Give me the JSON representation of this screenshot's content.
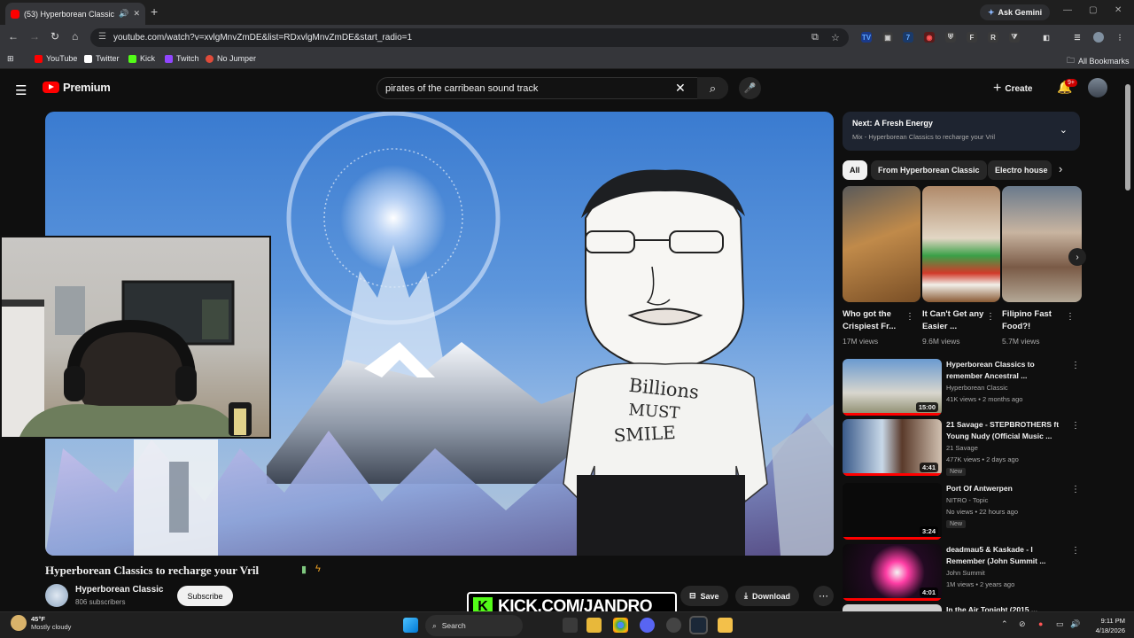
{
  "browser": {
    "tab_title": "(53) Hyperborean Classics to recharge your Vril",
    "new_tab_icon": "plus-icon",
    "gemini_label": "Ask Gemini",
    "url": "youtube.com/watch?v=xvlgMnvZmDE&list=RDxvlgMnvZmDE&start_radio=1",
    "bookmarks": [
      {
        "label": "YouTube",
        "color": "#ff0000"
      },
      {
        "label": "Twitter",
        "color": "#ffffff"
      },
      {
        "label": "Kick",
        "color": "#53fc18"
      },
      {
        "label": "Twitch",
        "color": "#9146ff"
      },
      {
        "label": "No Jumper",
        "color": "#e04b3a"
      }
    ],
    "all_bookmarks": "All Bookmarks"
  },
  "youtube": {
    "logo_text": "Premium",
    "search_value": "pirates of the carribean sound track",
    "create_label": "Create",
    "notif_count": "9+"
  },
  "video": {
    "title": "Hyperborean Classics to recharge your Vril",
    "channel": "Hyperborean Classic",
    "subscribers": "806 subscribers",
    "subscribe_label": "Subscribe",
    "save_label": "Save",
    "download_label": "Download",
    "shirt_line1": "Billions",
    "shirt_line2": "MUST",
    "shirt_line3": "SMILE"
  },
  "sidebar": {
    "up_next_label": "Next:",
    "up_next_title": "A Fresh Energy",
    "up_next_sub": "Mix - Hyperborean Classics to recharge your Vril",
    "chips": [
      "All",
      "From Hyperborean Classic",
      "Electro house"
    ],
    "shorts": [
      {
        "title": "Who got the Crispiest Fr...",
        "views": "17M views",
        "color": "#8a6a3c"
      },
      {
        "title": "It Can't Get any Easier ...",
        "views": "9.6M views",
        "color": "#9a5a3a"
      },
      {
        "title": "Filipino Fast Food?!",
        "views": "5.7M views",
        "color": "#7a6150"
      }
    ],
    "recs": [
      {
        "title": "Hyperborean Classics to remember Ancestral ...",
        "channel": "Hyperborean Classic",
        "views": "41K views • 2 months ago",
        "badge": "",
        "duration": "15:00"
      },
      {
        "title": "21 Savage - STEPBROTHERS ft Young Nudy (Official Music ...",
        "channel": "21 Savage",
        "views": "477K views • 2 days ago",
        "badge": "New",
        "duration": "4:41"
      },
      {
        "title": "Port Of Antwerpen",
        "channel": "NITRO - Topic",
        "views": "No views • 22 hours ago",
        "badge": "New",
        "duration": "3:24"
      },
      {
        "title": "deadmau5 & Kaskade - I Remember (John Summit ...",
        "channel": "John Summit",
        "views": "1M views • 2 years ago",
        "badge": "",
        "duration": "4:01"
      },
      {
        "title": "In the Air Tonight (2015 ...",
        "channel": "",
        "views": "",
        "badge": "",
        "duration": ""
      }
    ]
  },
  "overlay": {
    "kick_letter": "K",
    "kick_text": "KICK.COM/JANDRO"
  },
  "taskbar": {
    "temp": "45°F",
    "weather": "Mostly cloudy",
    "search_label": "Search",
    "time": "9:11 PM",
    "date": "4/18/2026"
  }
}
